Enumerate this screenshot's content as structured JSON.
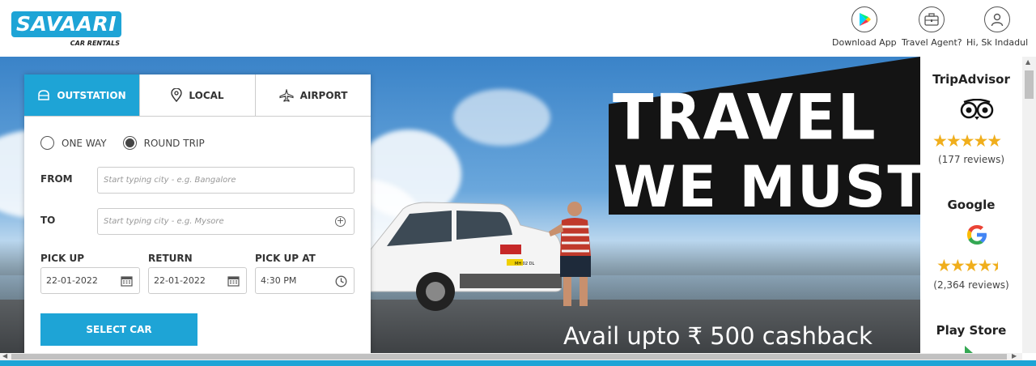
{
  "brand": {
    "name": "SAVAARI",
    "tagline": "CAR RENTALS",
    "color": "#1ea4d6"
  },
  "header_nav": [
    {
      "label": "Download App",
      "icon": "play-store-icon"
    },
    {
      "label": "Travel Agent?",
      "icon": "briefcase-icon"
    },
    {
      "label": "Hi, Sk Indadul",
      "icon": "user-icon"
    }
  ],
  "booking": {
    "tabs": [
      {
        "label": "OUTSTATION",
        "icon": "car-icon",
        "active": true
      },
      {
        "label": "LOCAL",
        "icon": "location-pin-icon",
        "active": false
      },
      {
        "label": "AIRPORT",
        "icon": "airplane-icon",
        "active": false
      }
    ],
    "trip_types": [
      {
        "label": "ONE WAY",
        "selected": false
      },
      {
        "label": "ROUND TRIP",
        "selected": true
      }
    ],
    "from": {
      "label": "FROM",
      "placeholder": "Start typing city - e.g. Bangalore",
      "value": ""
    },
    "to": {
      "label": "TO",
      "placeholder": "Start typing city - e.g. Mysore",
      "value": ""
    },
    "pickup": {
      "label": "PICK UP",
      "value": "22-01-2022"
    },
    "return": {
      "label": "RETURN",
      "value": "22-01-2022"
    },
    "pickup_at": {
      "label": "PICK UP AT",
      "value": "4:30 PM"
    },
    "submit_label": "SELECT CAR"
  },
  "hero": {
    "headline_1": "TRAVEL",
    "headline_2": "WE MUST",
    "offer": "Avail upto ₹ 500 cashback",
    "plate": "MH 02 DL"
  },
  "reviews": [
    {
      "source": "TripAdvisor",
      "stars": 5,
      "count": "(177 reviews)"
    },
    {
      "source": "Google",
      "stars": 4.5,
      "count": "(2,364 reviews)"
    },
    {
      "source": "Play Store"
    }
  ]
}
